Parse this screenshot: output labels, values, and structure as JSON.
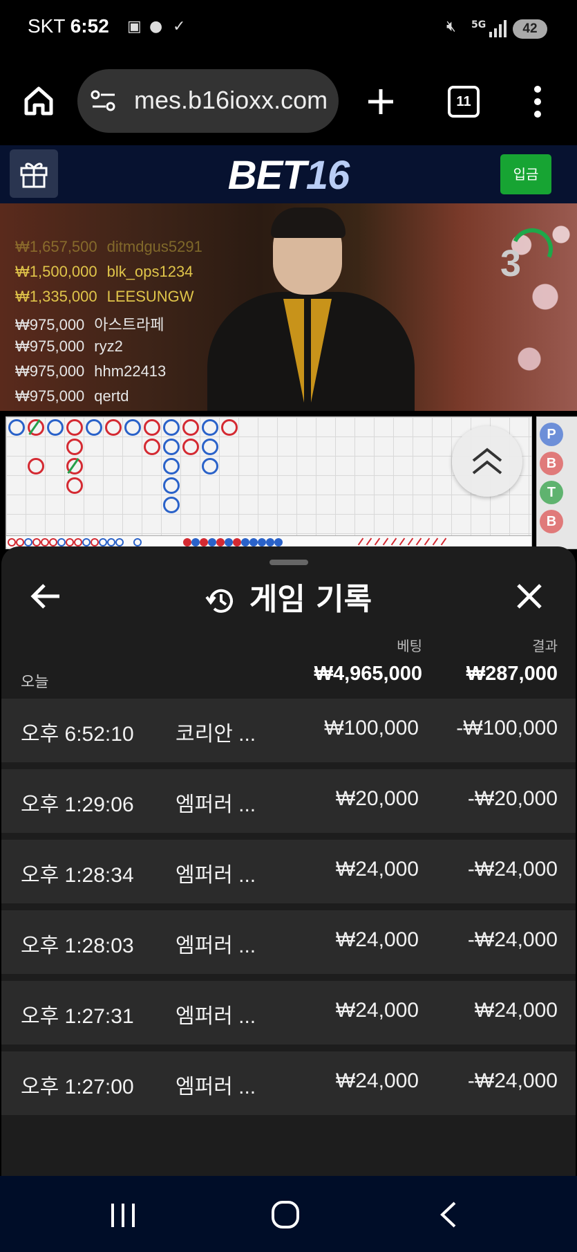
{
  "status_bar": {
    "carrier": "SKT",
    "time": "6:52",
    "network": "5G",
    "battery": "42"
  },
  "browser": {
    "url": "mes.b16ioxx.com",
    "tab_count": "11"
  },
  "site_header": {
    "logo_main": "BET",
    "logo_num": "16",
    "deposit_label": "입금"
  },
  "video": {
    "countdown": "3",
    "winners": [
      {
        "amount": "₩1,657,500",
        "user": "ditmdgus5291",
        "color": "#b8a23a",
        "opacity": 0.55
      },
      {
        "amount": "₩1,500,000",
        "user": "blk_ops1234",
        "color": "#e0c54a",
        "opacity": 1
      },
      {
        "amount": "₩1,335,000",
        "user": "LEESUNGW",
        "color": "#e0c54a",
        "opacity": 1
      },
      {
        "amount": "₩975,000",
        "user": "아스트라페",
        "color": "#e6e6e6",
        "opacity": 1
      },
      {
        "amount": "₩975,000",
        "user": "ryz2",
        "color": "#e6e6e6",
        "opacity": 1
      },
      {
        "amount": "₩975,000",
        "user": "hhm22413",
        "color": "#e6e6e6",
        "opacity": 1
      },
      {
        "amount": "₩975,000",
        "user": "qertd",
        "color": "#e6e6e6",
        "opacity": 1
      }
    ]
  },
  "side_chips": [
    {
      "label": "P",
      "color": "#6d8fd8"
    },
    {
      "label": "B",
      "color": "#e07a7a"
    },
    {
      "label": "T",
      "color": "#5fb36f"
    },
    {
      "label": "B",
      "color": "#e07a7a"
    }
  ],
  "history": {
    "title": "게임 기록",
    "col_bet": "베팅",
    "col_result": "결과",
    "today_label": "오늘",
    "total_bet": "₩4,965,000",
    "total_result": "₩287,000",
    "rows": [
      {
        "time": "오후 6:52:10",
        "game": "코리안 ...",
        "bet": "₩100,000",
        "result": "-₩100,000"
      },
      {
        "time": "오후 1:29:06",
        "game": "엠퍼러 ...",
        "bet": "₩20,000",
        "result": "-₩20,000"
      },
      {
        "time": "오후 1:28:34",
        "game": "엠퍼러 ...",
        "bet": "₩24,000",
        "result": "-₩24,000"
      },
      {
        "time": "오후 1:28:03",
        "game": "엠퍼러 ...",
        "bet": "₩24,000",
        "result": "-₩24,000"
      },
      {
        "time": "오후 1:27:31",
        "game": "엠퍼러 ...",
        "bet": "₩24,000",
        "result": "₩24,000"
      },
      {
        "time": "오후 1:27:00",
        "game": "엠퍼러 ...",
        "bet": "₩24,000",
        "result": "-₩24,000"
      }
    ]
  },
  "icons": {
    "home": "home-icon",
    "site_settings": "site-settings-icon",
    "new_tab": "plus-icon",
    "tabs": "tabs-icon",
    "menu": "more-vert-icon",
    "gift": "gift-icon",
    "history": "history-icon",
    "back": "arrow-left-icon",
    "close": "close-icon",
    "scroll_up": "double-chevron-up-icon",
    "nav_recents": "recents-icon",
    "nav_home": "nav-home-icon",
    "nav_back": "nav-back-icon"
  }
}
